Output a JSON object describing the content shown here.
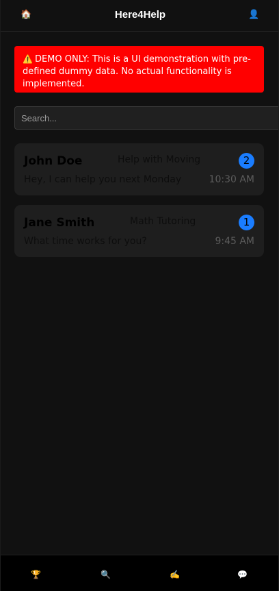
{
  "header": {
    "title": "Here4Help",
    "home_icon": "🏠",
    "profile_icon": "👤"
  },
  "banner": {
    "icon": "⚠️",
    "text": "DEMO ONLY: This is a UI demonstration with pre-defined dummy data. No actual functionality is implemented.",
    "color": "#ff0000"
  },
  "search": {
    "placeholder": "Search..."
  },
  "chats": [
    {
      "name": "John Doe",
      "topic": "Help with Moving",
      "unread": "2",
      "preview": "Hey, I can help you next Monday",
      "time": "10:30 AM"
    },
    {
      "name": "Jane Smith",
      "topic": "Math Tutoring",
      "unread": "1",
      "preview": "What time works for you?",
      "time": "9:45 AM"
    }
  ],
  "bottom_nav": {
    "trophy_icon": "🏆",
    "search_icon": "🔍",
    "write_icon": "✍️",
    "chat_icon": "💬"
  },
  "colors": {
    "accent": "#1a7dff",
    "background": "#111111",
    "card": "#1e1e1e"
  }
}
